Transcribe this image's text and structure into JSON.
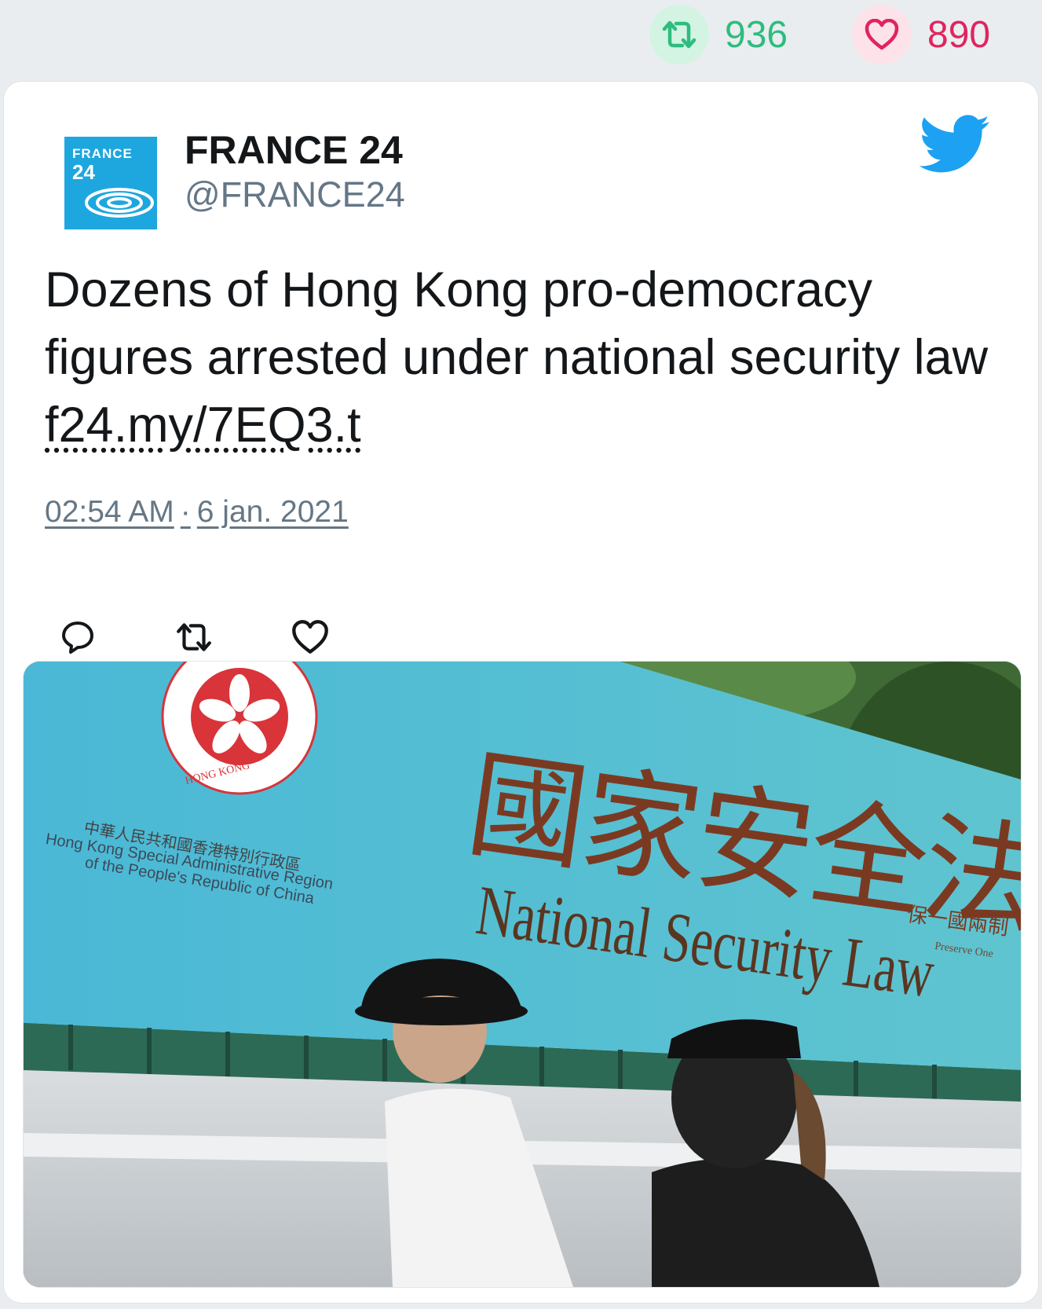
{
  "stats": {
    "retweets": "936",
    "likes": "890"
  },
  "account": {
    "name": "FRANCE 24",
    "handle": "@FRANCE24",
    "logo_line1": "FRANCE",
    "logo_line2": "24"
  },
  "tweet": {
    "text": "Dozens of Hong Kong pro-democracy figures arrested under national security law ",
    "link": "f24.my/7EQ3.t",
    "time": "02:54 AM",
    "separator": "·",
    "date": "6 jan. 2021"
  },
  "photo": {
    "banner_cn_small": "中華人民共和國香港特別行政區",
    "banner_en_line1": "Hong Kong Special Administrative Region",
    "banner_en_line2": "of the People's Republic of China",
    "emblem_text": "HONG KONG",
    "big_cn": "國家安全法",
    "big_en": "National Security Law",
    "side_cn": "保一國兩制",
    "side_en": "Preserve One"
  },
  "icons": [
    "retweet-icon",
    "heart-icon",
    "twitter-bird-icon",
    "reply-icon"
  ],
  "colors": {
    "retweet": "#2dbd7e",
    "like": "#e0245e",
    "twitter_blue": "#1da1f2",
    "muted": "#657786"
  }
}
